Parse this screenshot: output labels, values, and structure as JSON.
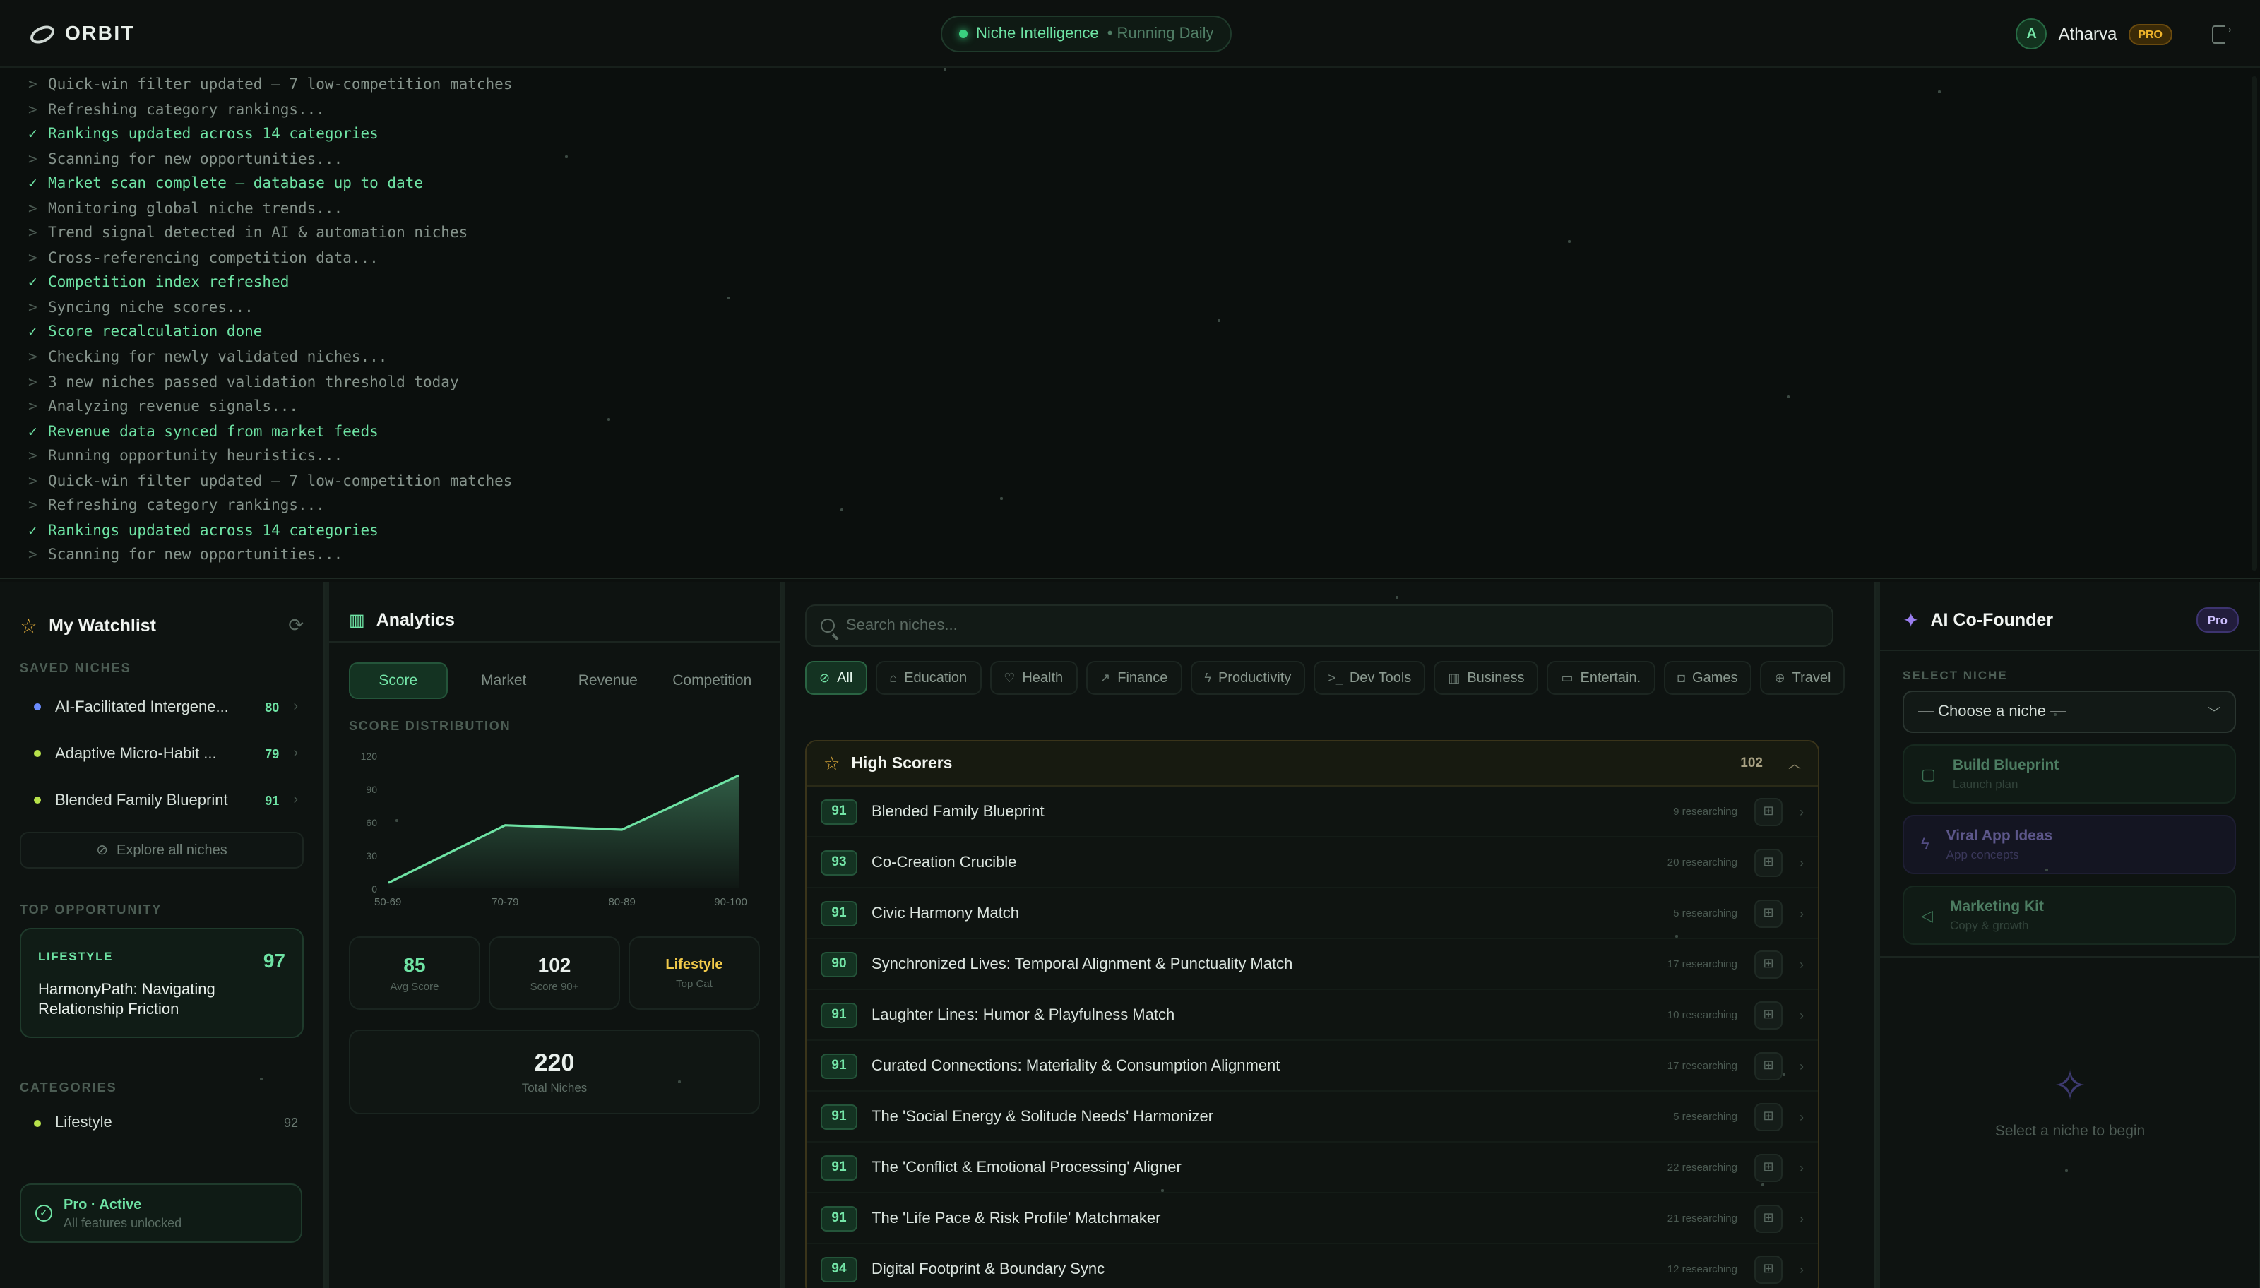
{
  "app": {
    "name": "ORBIT"
  },
  "status": {
    "label": "Niche Intelligence",
    "sub": "• Running Daily"
  },
  "user": {
    "initial": "A",
    "name": "Atharva",
    "badge": "PRO"
  },
  "log": [
    {
      "type": "run",
      "prefix": ">",
      "text": "Quick-win filter updated — 7 low-competition matches"
    },
    {
      "type": "run",
      "prefix": ">",
      "text": "Refreshing category rankings..."
    },
    {
      "type": "ok",
      "prefix": "✓",
      "text": "Rankings updated across 14 categories"
    },
    {
      "type": "run",
      "prefix": ">",
      "text": "Scanning for new opportunities..."
    },
    {
      "type": "ok",
      "prefix": "✓",
      "text": "Market scan complete — database up to date"
    },
    {
      "type": "run",
      "prefix": ">",
      "text": "Monitoring global niche trends..."
    },
    {
      "type": "run",
      "prefix": ">",
      "text": "Trend signal detected in AI & automation niches"
    },
    {
      "type": "run",
      "prefix": ">",
      "text": "Cross-referencing competition data..."
    },
    {
      "type": "ok",
      "prefix": "✓",
      "text": "Competition index refreshed"
    },
    {
      "type": "run",
      "prefix": ">",
      "text": "Syncing niche scores..."
    },
    {
      "type": "ok",
      "prefix": "✓",
      "text": "Score recalculation done"
    },
    {
      "type": "run",
      "prefix": ">",
      "text": "Checking for newly validated niches..."
    },
    {
      "type": "run",
      "prefix": ">",
      "text": "3 new niches passed validation threshold today"
    },
    {
      "type": "run",
      "prefix": ">",
      "text": "Analyzing revenue signals..."
    },
    {
      "type": "ok",
      "prefix": "✓",
      "text": "Revenue data synced from market feeds"
    },
    {
      "type": "run",
      "prefix": ">",
      "text": "Running opportunity heuristics..."
    },
    {
      "type": "run",
      "prefix": ">",
      "text": "Quick-win filter updated — 7 low-competition matches"
    },
    {
      "type": "run",
      "prefix": ">",
      "text": "Refreshing category rankings..."
    },
    {
      "type": "ok",
      "prefix": "✓",
      "text": "Rankings updated across 14 categories"
    },
    {
      "type": "run",
      "prefix": ">",
      "text": "Scanning for new opportunities..."
    }
  ],
  "watchlist": {
    "title": "My Watchlist",
    "saved_label": "SAVED NICHES",
    "items": [
      {
        "name": "AI-Facilitated Intergene...",
        "score": "80",
        "dot": "#6b8cff"
      },
      {
        "name": "Adaptive Micro-Habit ...",
        "score": "79",
        "dot": "#b7e24a"
      },
      {
        "name": "Blended Family Blueprint",
        "score": "91",
        "dot": "#b7e24a"
      }
    ],
    "explore": "Explore all niches",
    "top_label": "TOP OPPORTUNITY",
    "top": {
      "category": "LIFESTYLE",
      "score": "97",
      "name": "HarmonyPath: Navigating Relationship Friction"
    },
    "categories_label": "CATEGORIES",
    "categories": [
      {
        "name": "Lifestyle",
        "count": "92"
      }
    ],
    "pro": {
      "title": "Pro · Active",
      "sub": "All features unlocked"
    }
  },
  "analytics": {
    "title": "Analytics",
    "tabs": [
      "Score",
      "Market",
      "Revenue",
      "Competition"
    ],
    "dist_label": "SCORE DISTRIBUTION",
    "stats": [
      {
        "value": "85",
        "label": "Avg Score"
      },
      {
        "value": "102",
        "label": "Score 90+"
      },
      {
        "value": "Lifestyle",
        "label": "Top Cat"
      }
    ],
    "total": {
      "value": "220",
      "label": "Total Niches"
    }
  },
  "chart_data": {
    "type": "area",
    "categories": [
      "50-69",
      "70-79",
      "80-89",
      "90-100"
    ],
    "values": [
      5,
      57,
      53,
      102
    ],
    "yticks": [
      0,
      30,
      60,
      90,
      120
    ],
    "ylim": [
      0,
      120
    ],
    "color": "#6ee3a4"
  },
  "list": {
    "search_placeholder": "Search niches...",
    "filters": [
      {
        "label": "All",
        "icon": "⊘"
      },
      {
        "label": "Education",
        "icon": "⌂"
      },
      {
        "label": "Health",
        "icon": "♡"
      },
      {
        "label": "Finance",
        "icon": "↗"
      },
      {
        "label": "Productivity",
        "icon": "ϟ"
      },
      {
        "label": "Dev Tools",
        "icon": ">_"
      },
      {
        "label": "Business",
        "icon": "▥"
      },
      {
        "label": "Entertain.",
        "icon": "▭"
      },
      {
        "label": "Games",
        "icon": "◘"
      },
      {
        "label": "Travel",
        "icon": "⊕"
      }
    ],
    "group": {
      "title": "High Scorers",
      "count": "102"
    },
    "rows": [
      {
        "score": "91",
        "name": "Blended Family Blueprint",
        "meta": "9 researching"
      },
      {
        "score": "93",
        "name": "Co-Creation Crucible",
        "meta": "20 researching"
      },
      {
        "score": "91",
        "name": "Civic Harmony Match",
        "meta": "5 researching"
      },
      {
        "score": "90",
        "name": "Synchronized Lives: Temporal Alignment & Punctuality Match",
        "meta": "17 researching"
      },
      {
        "score": "91",
        "name": "Laughter Lines: Humor & Playfulness Match",
        "meta": "10 researching"
      },
      {
        "score": "91",
        "name": "Curated Connections: Materiality & Consumption Alignment",
        "meta": "17 researching"
      },
      {
        "score": "91",
        "name": "The 'Social Energy & Solitude Needs' Harmonizer",
        "meta": "5 researching"
      },
      {
        "score": "91",
        "name": "The 'Conflict & Emotional Processing' Aligner",
        "meta": "22 researching"
      },
      {
        "score": "91",
        "name": "The 'Life Pace & Risk Profile' Matchmaker",
        "meta": "21 researching"
      },
      {
        "score": "94",
        "name": "Digital Footprint & Boundary Sync",
        "meta": "12 researching"
      }
    ]
  },
  "ai": {
    "title": "AI Co-Founder",
    "badge": "Pro",
    "select_label": "SELECT NICHE",
    "select_value": "— Choose a niche —",
    "cards": [
      {
        "title": "Build Blueprint",
        "sub": "Launch plan",
        "tone": "green",
        "icon": "▢"
      },
      {
        "title": "Viral App Ideas",
        "sub": "App concepts",
        "tone": "purple",
        "icon": "ϟ"
      },
      {
        "title": "Marketing Kit",
        "sub": "Copy & growth",
        "tone": "green",
        "icon": "◁"
      }
    ],
    "empty": "Select a niche to begin"
  }
}
